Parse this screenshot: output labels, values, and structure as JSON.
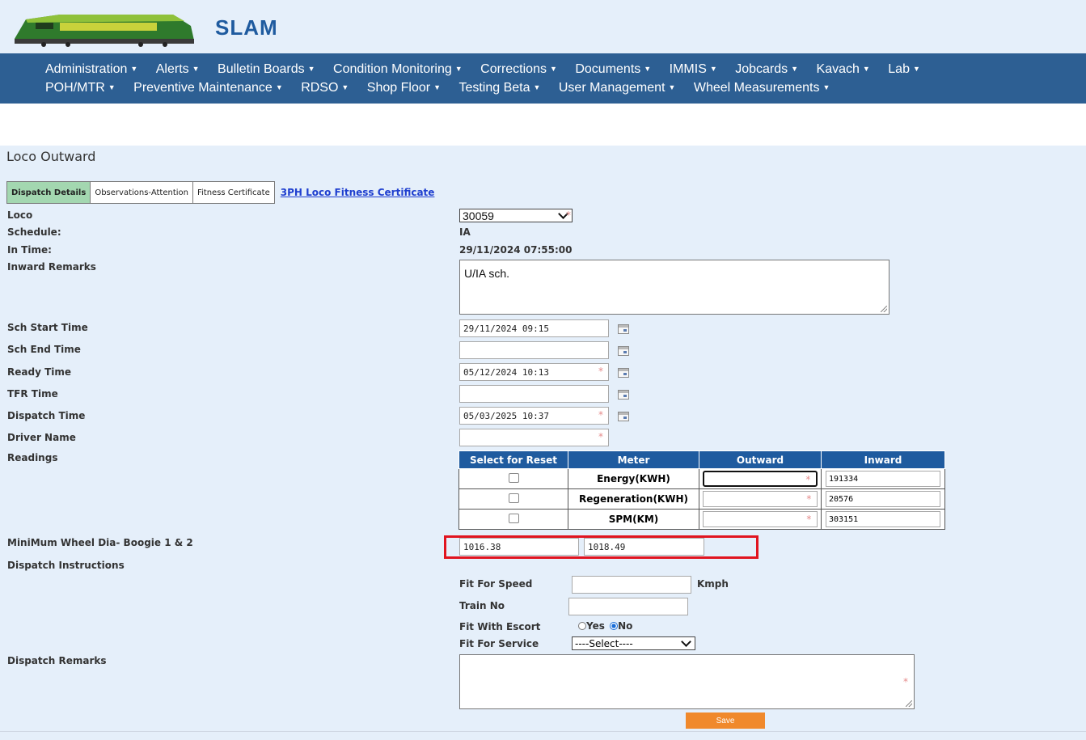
{
  "app": {
    "brand": "SLAM"
  },
  "nav": {
    "row1": [
      "Administration",
      "Alerts",
      "Bulletin Boards",
      "Condition Monitoring",
      "Corrections",
      "Documents",
      "IMMIS",
      "Jobcards",
      "Kavach",
      "Lab"
    ],
    "row2": [
      "POH/MTR",
      "Preventive Maintenance",
      "RDSO",
      "Shop Floor",
      "Testing Beta",
      "User Management",
      "Wheel Measurements"
    ]
  },
  "page": {
    "title": "Loco Outward"
  },
  "tabs": {
    "dispatch": "Dispatch Details",
    "observations": "Observations-Attention",
    "fitness": "Fitness Certificate",
    "link": "3PH Loco Fitness Certificate"
  },
  "form": {
    "loco": {
      "label": "Loco",
      "value": "30059"
    },
    "schedule": {
      "label": "Schedule:",
      "value": "IA"
    },
    "in_time": {
      "label": "In Time:",
      "value": "29/11/2024 07:55:00"
    },
    "inward_remarks": {
      "label": "Inward Remarks",
      "value": "U/IA sch."
    },
    "sch_start": {
      "label": "Sch Start Time",
      "value": "29/11/2024 09:15"
    },
    "sch_end": {
      "label": "Sch End Time",
      "value": ""
    },
    "ready": {
      "label": "Ready Time",
      "value": "05/12/2024 10:13"
    },
    "tfr": {
      "label": "TFR Time",
      "value": ""
    },
    "dispatch": {
      "label": "Dispatch Time",
      "value": "05/03/2025 10:37"
    },
    "driver": {
      "label": "Driver Name",
      "value": ""
    },
    "readings_label": "Readings",
    "wheel": {
      "label": "MiniMum Wheel Dia- Boogie 1 & 2",
      "boogie1": "1016.38",
      "boogie2": "1018.49"
    },
    "dispatch_instructions": "Dispatch Instructions",
    "fit_speed": {
      "label": "Fit For Speed",
      "unit": "Kmph",
      "value": ""
    },
    "train_no": {
      "label": "Train No",
      "value": ""
    },
    "escort": {
      "label": "Fit With Escort",
      "yes": "Yes",
      "no": "No",
      "selected": "No"
    },
    "fit_service": {
      "label": "Fit For Service",
      "value": "----Select----"
    },
    "dispatch_remarks": {
      "label": "Dispatch Remarks",
      "value": ""
    },
    "save": "Save"
  },
  "readings": {
    "headers": [
      "Select for Reset",
      "Meter",
      "Outward",
      "Inward"
    ],
    "rows": [
      {
        "meter": "Energy(KWH)",
        "outward": "",
        "inward": "191334"
      },
      {
        "meter": "Regeneration(KWH)",
        "outward": "",
        "inward": "20576"
      },
      {
        "meter": "SPM(KM)",
        "outward": "",
        "inward": "303151"
      }
    ]
  },
  "colors": {
    "nav": "#2d5f93",
    "header_bg": "#e5effa",
    "table_head": "#1f5b9f",
    "active_tab": "#a3d7b0",
    "save": "#f0892c",
    "highlight": "#e1141f"
  }
}
